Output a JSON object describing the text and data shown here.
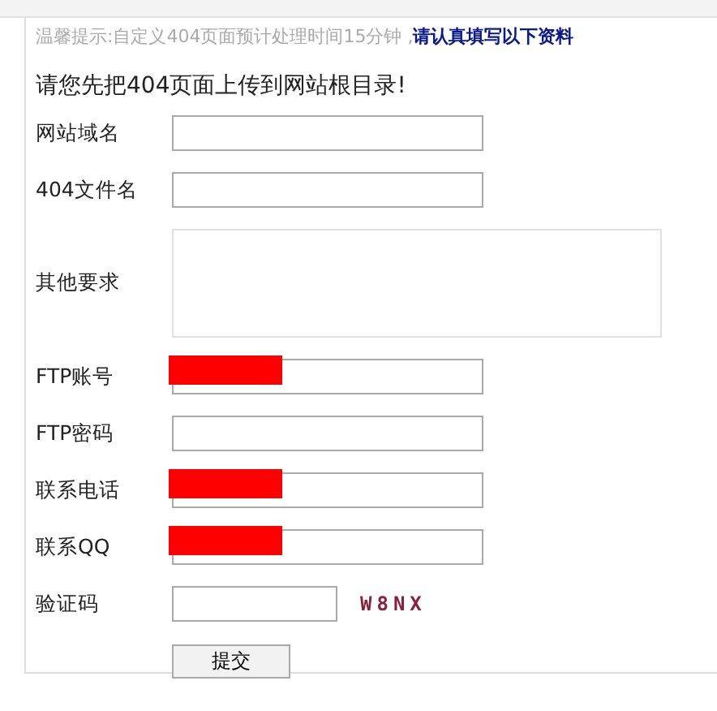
{
  "notice": {
    "hint": "温馨提示:自定义404页面预计处理时间15分钟 ,",
    "emphasis": "请认真填写以下资料"
  },
  "heading": "请您先把404页面上传到网站根目录!",
  "fields": [
    {
      "kind": "input",
      "label": "网站域名",
      "redacted": false
    },
    {
      "kind": "input",
      "label": "404文件名",
      "redacted": false
    },
    {
      "kind": "textarea",
      "label": "其他要求",
      "redacted": false
    },
    {
      "kind": "input",
      "label": "FTP账号",
      "redacted": true
    },
    {
      "kind": "input",
      "label": "FTP密码",
      "redacted": false
    },
    {
      "kind": "input",
      "label": "联系电话",
      "redacted": true
    },
    {
      "kind": "input",
      "label": "联系QQ",
      "redacted": true
    },
    {
      "kind": "captcha",
      "label": "验证码",
      "redacted": false,
      "code": "W8NX"
    }
  ],
  "submit": "提交"
}
